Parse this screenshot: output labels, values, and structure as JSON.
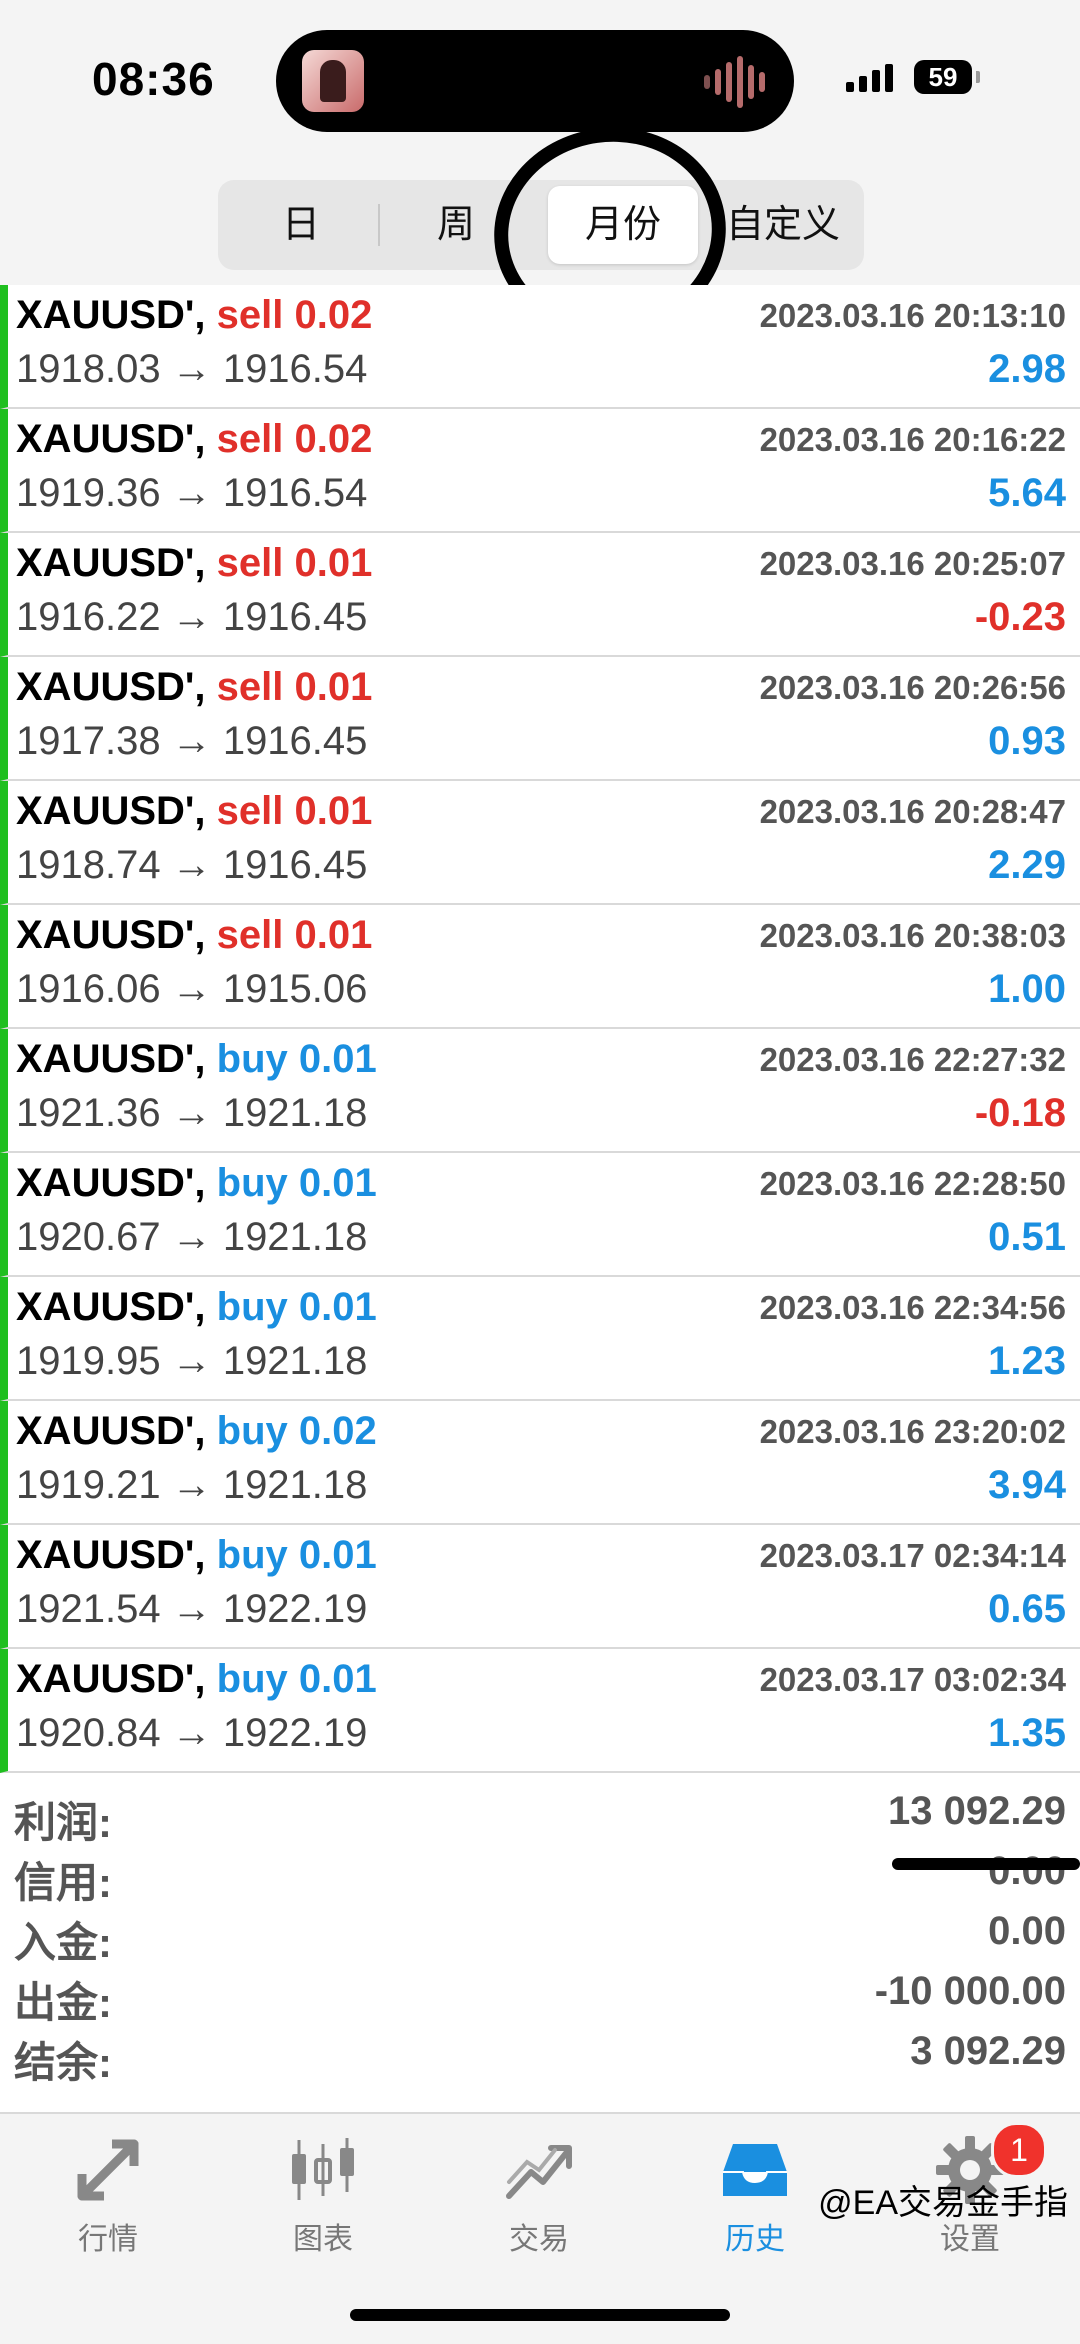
{
  "status_bar": {
    "time": "08:36",
    "battery": "59"
  },
  "segments": [
    {
      "label": "日",
      "active": false
    },
    {
      "label": "周",
      "active": false
    },
    {
      "label": "月份",
      "active": true
    },
    {
      "label": "自定义",
      "active": false
    }
  ],
  "trades": [
    {
      "symbol": "XAUUSD',",
      "type": "sell 0.02",
      "side": "sell",
      "time": "2023.03.16 20:13:10",
      "prices": "1918.03 → 1916.54",
      "profit": "2.98"
    },
    {
      "symbol": "XAUUSD',",
      "type": "sell 0.02",
      "side": "sell",
      "time": "2023.03.16 20:16:22",
      "prices": "1919.36 → 1916.54",
      "profit": "5.64"
    },
    {
      "symbol": "XAUUSD',",
      "type": "sell 0.01",
      "side": "sell",
      "time": "2023.03.16 20:25:07",
      "prices": "1916.22 → 1916.45",
      "profit": "-0.23"
    },
    {
      "symbol": "XAUUSD',",
      "type": "sell 0.01",
      "side": "sell",
      "time": "2023.03.16 20:26:56",
      "prices": "1917.38 → 1916.45",
      "profit": "0.93"
    },
    {
      "symbol": "XAUUSD',",
      "type": "sell 0.01",
      "side": "sell",
      "time": "2023.03.16 20:28:47",
      "prices": "1918.74 → 1916.45",
      "profit": "2.29"
    },
    {
      "symbol": "XAUUSD',",
      "type": "sell 0.01",
      "side": "sell",
      "time": "2023.03.16 20:38:03",
      "prices": "1916.06 → 1915.06",
      "profit": "1.00"
    },
    {
      "symbol": "XAUUSD',",
      "type": "buy 0.01",
      "side": "buy",
      "time": "2023.03.16 22:27:32",
      "prices": "1921.36 → 1921.18",
      "profit": "-0.18"
    },
    {
      "symbol": "XAUUSD',",
      "type": "buy 0.01",
      "side": "buy",
      "time": "2023.03.16 22:28:50",
      "prices": "1920.67 → 1921.18",
      "profit": "0.51"
    },
    {
      "symbol": "XAUUSD',",
      "type": "buy 0.01",
      "side": "buy",
      "time": "2023.03.16 22:34:56",
      "prices": "1919.95 → 1921.18",
      "profit": "1.23"
    },
    {
      "symbol": "XAUUSD',",
      "type": "buy 0.02",
      "side": "buy",
      "time": "2023.03.16 23:20:02",
      "prices": "1919.21 → 1921.18",
      "profit": "3.94"
    },
    {
      "symbol": "XAUUSD',",
      "type": "buy 0.01",
      "side": "buy",
      "time": "2023.03.17 02:34:14",
      "prices": "1921.54 → 1922.19",
      "profit": "0.65"
    },
    {
      "symbol": "XAUUSD',",
      "type": "buy 0.01",
      "side": "buy",
      "time": "2023.03.17 03:02:34",
      "prices": "1920.84 → 1922.19",
      "profit": "1.35"
    }
  ],
  "summary": [
    {
      "label": "利润:",
      "value": "13 092.29"
    },
    {
      "label": "信用:",
      "value": "0.00"
    },
    {
      "label": "入金:",
      "value": "0.00"
    },
    {
      "label": "出金:",
      "value": "-10 000.00"
    },
    {
      "label": "结余:",
      "value": "3 092.29"
    }
  ],
  "tabs": [
    {
      "label": "行情",
      "icon": "quotes-icon",
      "active": false
    },
    {
      "label": "图表",
      "icon": "chart-icon",
      "active": false
    },
    {
      "label": "交易",
      "icon": "trade-icon",
      "active": false
    },
    {
      "label": "历史",
      "icon": "history-icon",
      "active": true
    },
    {
      "label": "设置",
      "icon": "settings-icon",
      "active": false,
      "badge": "1"
    }
  ],
  "watermark": "@EA交易金手指",
  "colors": {
    "sell": "#e0302a",
    "buy": "#1a8fe0",
    "positive": "#1a8fe0",
    "negative": "#e0302a",
    "row_marker": "#1fbf1f",
    "active_tab": "#1a8fe0"
  }
}
